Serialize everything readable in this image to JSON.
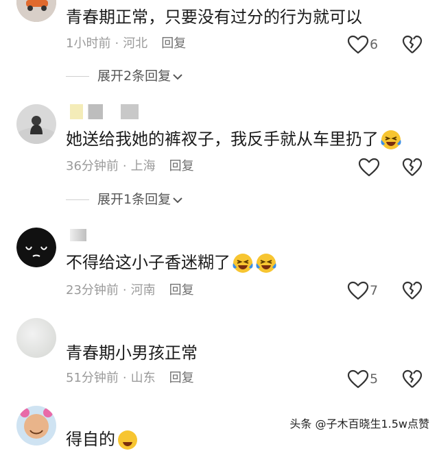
{
  "comments": [
    {
      "text": "青春期正常，只要没有过分的行为就可以",
      "time": "1小时前",
      "location": "河北",
      "reply_label": "回复",
      "likes": "6",
      "expand_label": "展开2条回复"
    },
    {
      "text": "她送给我她的裤衩子，我反手就从车里扔了",
      "time": "36分钟前",
      "location": "上海",
      "reply_label": "回复",
      "likes": "",
      "expand_label": "展开1条回复"
    },
    {
      "text": "不得给这小子香迷糊了",
      "time": "23分钟前",
      "location": "河南",
      "reply_label": "回复",
      "likes": "7"
    },
    {
      "text": "青春期小男孩正常",
      "time": "51分钟前",
      "location": "山东",
      "reply_label": "回复",
      "likes": "5"
    },
    {
      "text": "得自的"
    }
  ],
  "watermark": "头条 @子木百晓生1.5w点赞",
  "colors": {
    "meta_text": "#9a9a9a",
    "icon_stroke": "#333333",
    "emoji_face": "#f7c531",
    "emoji_tears": "#3a8ee6"
  },
  "icons": {
    "like": "heart-outline-icon",
    "dislike": "broken-heart-icon",
    "expand": "chevron-down-icon",
    "emoji": "laughing-tears-emoji"
  }
}
